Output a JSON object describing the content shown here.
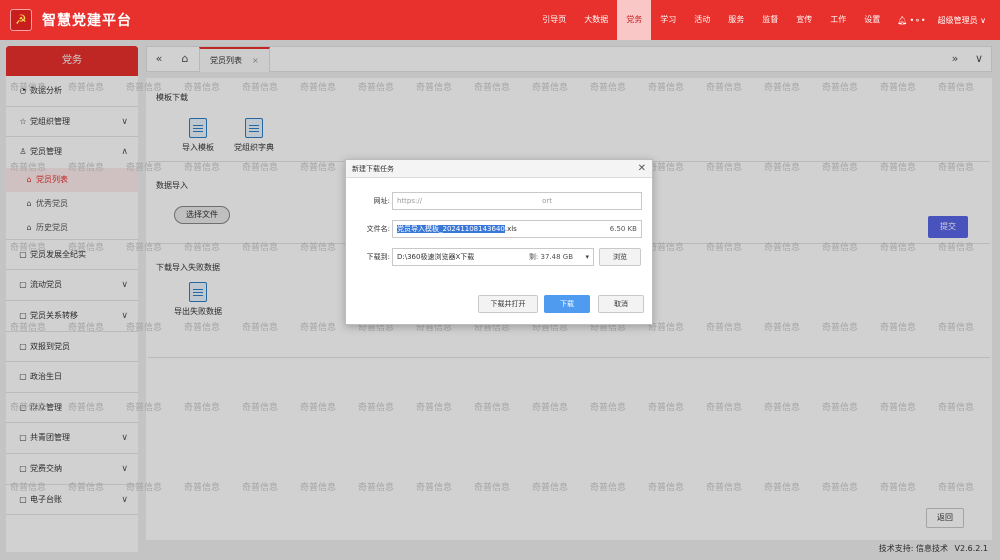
{
  "header": {
    "app_title": "智慧党建平台",
    "nav": [
      "引导页",
      "大数据",
      "党务",
      "学习",
      "活动",
      "服务",
      "监督",
      "宣传",
      "工作",
      "设置"
    ],
    "active_nav": "党务",
    "user": "超级管理员",
    "accent_color": "#e8302c"
  },
  "sidebar": {
    "title": "党务",
    "items": [
      {
        "label": "数据分析",
        "icon": "chart-icon"
      },
      {
        "label": "党组织管理",
        "icon": "star-icon"
      },
      {
        "label": "党员管理",
        "icon": "user-icon"
      },
      {
        "label": "党员发展全纪实",
        "icon": "doc-icon"
      },
      {
        "label": "流动党员",
        "icon": "doc-icon"
      },
      {
        "label": "党员关系转移",
        "icon": "doc-icon"
      },
      {
        "label": "双报到党员",
        "icon": "doc-icon"
      },
      {
        "label": "政治生日",
        "icon": "doc-icon"
      },
      {
        "label": "群众管理",
        "icon": "doc-icon"
      },
      {
        "label": "共青团管理",
        "icon": "doc-icon"
      },
      {
        "label": "党费交纳",
        "icon": "doc-icon"
      },
      {
        "label": "电子台账",
        "icon": "doc-icon"
      }
    ],
    "sub_items": [
      "党员列表",
      "优秀党员",
      "历史党员"
    ]
  },
  "tabs": {
    "active": "党员列表"
  },
  "main": {
    "template_section": "模板下载",
    "import_template": "导入模板",
    "org_dict": "党组织字典",
    "import_section": "数据导入",
    "choose_file": "选择文件",
    "submit": "提交",
    "failed_section": "下载导入失败数据",
    "export_failed": "导出失败数据",
    "return": "返回"
  },
  "watermark": "奇普信息",
  "dialog": {
    "title": "新建下载任务",
    "url_label": "网址:",
    "url_value": "https://",
    "url_tail": "ort",
    "filename_label": "文件名:",
    "filename_value": "党员导入模板_20241108143640",
    "filename_ext": ".xls",
    "file_size": "6.50 KB",
    "saveto_label": "下载到:",
    "saveto_value": "D:\\360极速浏览器X下载",
    "free_space": "剩: 37.48 GB",
    "browse": "浏览",
    "download_open": "下载并打开",
    "download": "下载",
    "cancel": "取消"
  },
  "footer": {
    "support": "技术支持: 信息技术",
    "version": "V2.6.2.1"
  }
}
